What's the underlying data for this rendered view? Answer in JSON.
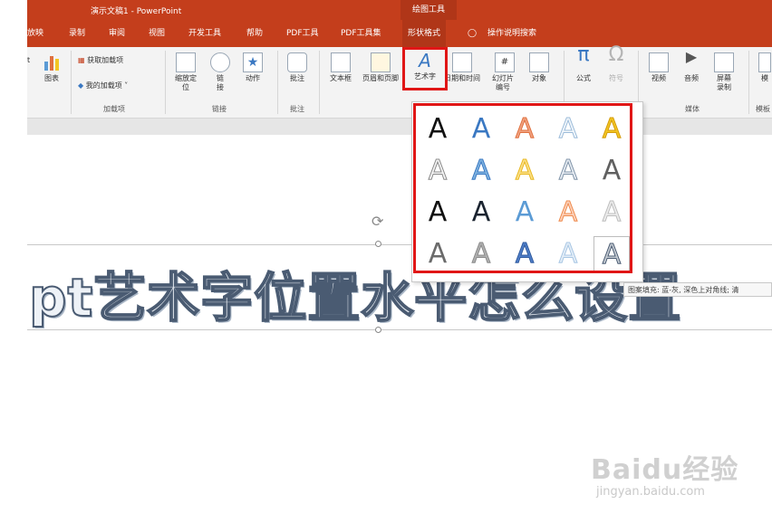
{
  "title_bar": {
    "doc_title": "演示文稿1 - PowerPoint",
    "drawing_tools": "绘图工具"
  },
  "tabs": [
    "放映",
    "录制",
    "审阅",
    "视图",
    "开发工具",
    "帮助",
    "PDF工具",
    "PDF工具集",
    "形状格式",
    "操作说明搜索"
  ],
  "ribbon": {
    "groups": {
      "addins": "加载项",
      "links": "链接",
      "comments": "批注",
      "media": "媒体",
      "template": "模板"
    },
    "items": {
      "chart_partial": "t",
      "chart": "图表",
      "get_addins": "获取加载项",
      "my_addins": "我的加载项",
      "zoom": "缩放定位",
      "link": "链接",
      "action": "动作",
      "comment": "批注",
      "textbox": "文本框",
      "header_footer": "页眉和页脚",
      "wordart": "艺术字",
      "datetime": "日期和时间",
      "slide_number": "幻灯片编号",
      "object": "对象",
      "equation": "公式",
      "symbol": "符号",
      "video": "视频",
      "audio": "音频",
      "screen_recording": "屏幕录制",
      "template_partial": "模"
    }
  },
  "slide": {
    "wordart_text": "pt艺术字位置水平怎么设置"
  },
  "gallery": {
    "letter": "A",
    "styles": [
      {
        "fill": "#111111",
        "stroke": "none"
      },
      {
        "fill": "#3a78c2",
        "stroke": "none"
      },
      {
        "fill": "#f0a382",
        "stroke": "#e0703e"
      },
      {
        "fill": "#f4f8fc",
        "stroke": "#9bbbd9"
      },
      {
        "fill": "#f3c623",
        "stroke": "#d49b0a"
      },
      {
        "fill": "#f6f6f6",
        "stroke": "#8a8a8a"
      },
      {
        "fill": "#7fb3e0",
        "stroke": "#3a78c2"
      },
      {
        "fill": "#fbe08a",
        "stroke": "#e8b820"
      },
      {
        "fill": "#e9eef4",
        "stroke": "#7f93a8"
      },
      {
        "fill": "#606060",
        "stroke": "none"
      },
      {
        "fill": "#111111",
        "stroke": "none"
      },
      {
        "fill": "#1b2430",
        "stroke": "none"
      },
      {
        "fill": "#5b9bd5",
        "stroke": "none"
      },
      {
        "fill": "#fcd3bd",
        "stroke": "#ef8a4c"
      },
      {
        "fill": "#ededed",
        "stroke": "#bdbdbd"
      },
      {
        "fill": "#6b6b6b",
        "stroke": "none"
      },
      {
        "fill": "#b0b0b0",
        "stroke": "#8a8a8a"
      },
      {
        "fill": "#4f7ec8",
        "stroke": "#2f5a9e"
      },
      {
        "fill": "#e4eef8",
        "stroke": "#a8c6e3"
      },
      {
        "fill": "#c6ccd3",
        "stroke": "#4a5b72"
      }
    ]
  },
  "tooltip": "图案填充: 蓝-灰, 深色上对角线; 清",
  "watermark": {
    "brand": "Baidu经验",
    "url": "jingyan.baidu.com"
  },
  "colors": {
    "accent": "#c43e1c",
    "highlight": "#e01616"
  }
}
